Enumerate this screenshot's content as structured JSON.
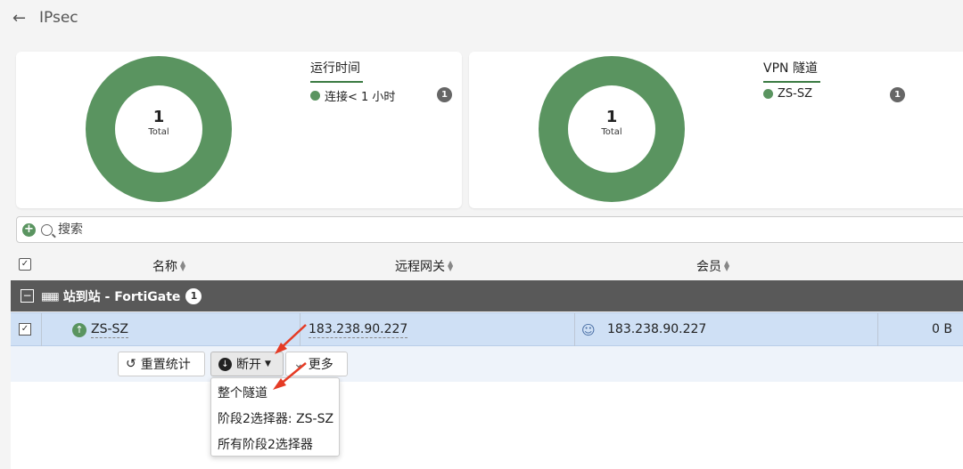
{
  "header": {
    "title": "IPsec"
  },
  "cards": [
    {
      "total": "1",
      "total_label": "Total",
      "legend_title": "运行时间",
      "legend_item": "连接< 1 小时",
      "legend_count": "1"
    },
    {
      "total": "1",
      "total_label": "Total",
      "legend_title": "VPN 隧道",
      "legend_item": "ZS-SZ",
      "legend_count": "1"
    }
  ],
  "search": {
    "placeholder": "搜索"
  },
  "table": {
    "columns": [
      "名称",
      "远程网关",
      "会员"
    ],
    "group": {
      "label": "站到站 - FortiGate",
      "count": "1"
    },
    "row": {
      "name": "ZS-SZ",
      "gateway": "183.238.90.227",
      "member": "183.238.90.227",
      "bytes": "0 B"
    }
  },
  "actions": {
    "reset": "重置统计",
    "disconnect": "断开",
    "more": "更多"
  },
  "dropdown": [
    "整个隧道",
    "阶段2选择器: ZS-SZ",
    "所有阶段2选择器"
  ],
  "colors": {
    "donut": "#5a9460",
    "accent": "#3a7a42",
    "group_bar": "#595959",
    "row_selected": "#cfe0f5",
    "annotation": "#e53b25"
  }
}
